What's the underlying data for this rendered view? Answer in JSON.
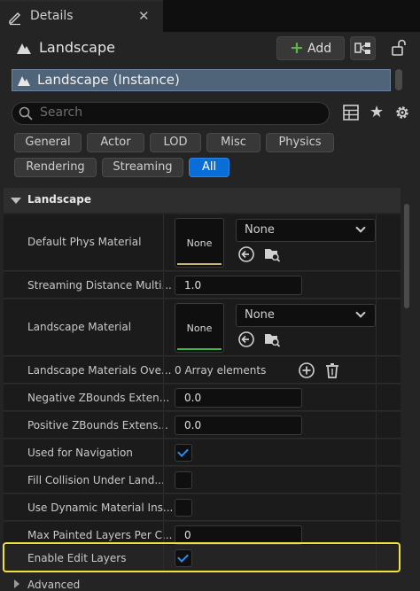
{
  "tab": {
    "title": "Details",
    "close_glyph": "✕",
    "icon": "pencil-icon"
  },
  "header": {
    "title": "Landscape",
    "add_label": "Add",
    "add_icon": "plus-icon",
    "blueprint_icon": "blueprint-icon",
    "lock_icon": "lock-open-icon"
  },
  "instance": {
    "label": "Landscape (Instance)"
  },
  "search": {
    "placeholder": "Search"
  },
  "filters": [
    "General",
    "Actor",
    "LOD",
    "Misc",
    "Physics",
    "Rendering",
    "Streaming",
    "All"
  ],
  "active_filter": "All",
  "category": {
    "label": "Landscape"
  },
  "properties": {
    "default_phys_material": {
      "label": "Default Phys Material",
      "thumb": "None",
      "value": "None"
    },
    "streaming_distance": {
      "label": "Streaming Distance Multi...",
      "value": "1.0"
    },
    "landscape_material": {
      "label": "Landscape Material",
      "thumb": "None",
      "value": "None"
    },
    "materials_override": {
      "label": "Landscape Materials Ove...",
      "value": "0 Array elements"
    },
    "neg_zbounds": {
      "label": "Negative ZBounds Exten...",
      "value": "0.0"
    },
    "pos_zbounds": {
      "label": "Positive ZBounds Extens...",
      "value": "0.0"
    },
    "used_for_navigation": {
      "label": "Used for Navigation",
      "checked": true
    },
    "fill_collision": {
      "label": "Fill Collision Under Land...",
      "checked": false
    },
    "dynamic_material": {
      "label": "Use Dynamic Material Ins...",
      "checked": false
    },
    "max_painted_layers": {
      "label": "Max Painted Layers Per C...",
      "value": "0"
    },
    "enable_edit_layers": {
      "label": "Enable Edit Layers",
      "checked": true
    }
  },
  "advanced": {
    "label": "Advanced"
  },
  "colors": {
    "accent_blue": "#0a6ed8",
    "add_green": "#5db54a",
    "highlight_yellow": "#f2e33b",
    "phys_material_bar": "#c8b46e",
    "material_bar": "#3db84a"
  }
}
